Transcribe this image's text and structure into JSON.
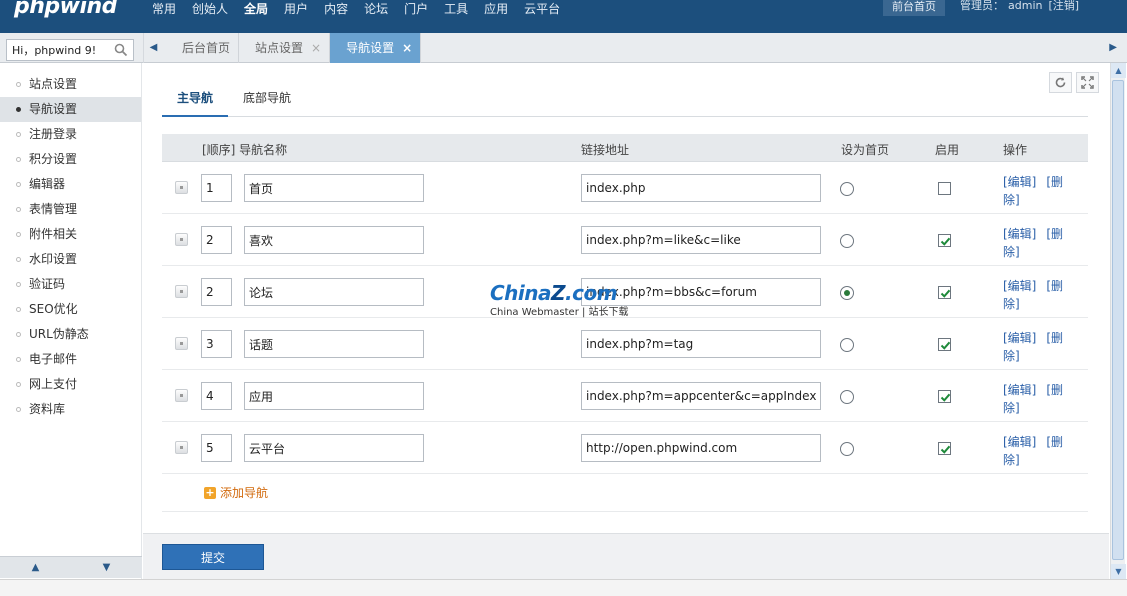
{
  "header": {
    "logo": "phpwind",
    "nav": [
      "常用",
      "创始人",
      "全局",
      "用户",
      "内容",
      "论坛",
      "门户",
      "工具",
      "应用",
      "云平台"
    ],
    "nav_active_index": 2,
    "front_page_label": "前台首页",
    "admin_label": "管理员：",
    "admin_user": "admin",
    "logout_label": "[注销]"
  },
  "search": {
    "value": "Hi，phpwind 9!"
  },
  "tabs": [
    {
      "label": "后台首页",
      "closable": false,
      "active": false
    },
    {
      "label": "站点设置",
      "closable": true,
      "active": false
    },
    {
      "label": "导航设置",
      "closable": true,
      "active": true
    }
  ],
  "sidebar": {
    "items": [
      "站点设置",
      "导航设置",
      "注册登录",
      "积分设置",
      "编辑器",
      "表情管理",
      "附件相关",
      "水印设置",
      "验证码",
      "SEO优化",
      "URL伪静态",
      "电子邮件",
      "网上支付",
      "资料库"
    ],
    "active_index": 1
  },
  "subtabs": [
    "主导航",
    "底部导航"
  ],
  "table": {
    "headers": {
      "order_name": "[顺序] 导航名称",
      "link": "链接地址",
      "home": "设为首页",
      "enable": "启用",
      "ops": "操作"
    },
    "edit_label": "[编辑]",
    "delete_label": "[删除]",
    "rows": [
      {
        "order": "1",
        "name": "首页",
        "link": "index.php",
        "home": false,
        "enabled": false
      },
      {
        "order": "2",
        "name": "喜欢",
        "link": "index.php?m=like&c=like",
        "home": false,
        "enabled": true
      },
      {
        "order": "2",
        "name": "论坛",
        "link": "index.php?m=bbs&c=forum",
        "home": true,
        "enabled": true
      },
      {
        "order": "3",
        "name": "话题",
        "link": "index.php?m=tag",
        "home": false,
        "enabled": true
      },
      {
        "order": "4",
        "name": "应用",
        "link": "index.php?m=appcenter&c=appIndex",
        "home": false,
        "enabled": true
      },
      {
        "order": "5",
        "name": "云平台",
        "link": "http://open.phpwind.com",
        "home": false,
        "enabled": true
      }
    ],
    "add_label": "添加导航"
  },
  "submit_label": "提交",
  "watermark": {
    "brand_main": "China",
    "brand_z": "Z",
    "brand_com": ".com",
    "subtitle": "China Webmaster | 站长下载"
  },
  "icons": {
    "search": "search-icon",
    "refresh": "refresh-icon",
    "fullscreen": "fullscreen-icon",
    "close": "close-icon",
    "check": "check-icon",
    "plus": "plus-icon"
  },
  "colors": {
    "topbar": "#1c4f7d",
    "active_tab": "#6aa2d0",
    "link": "#2a5fa8",
    "submit": "#2f71b7",
    "add": "#d26a0d"
  }
}
